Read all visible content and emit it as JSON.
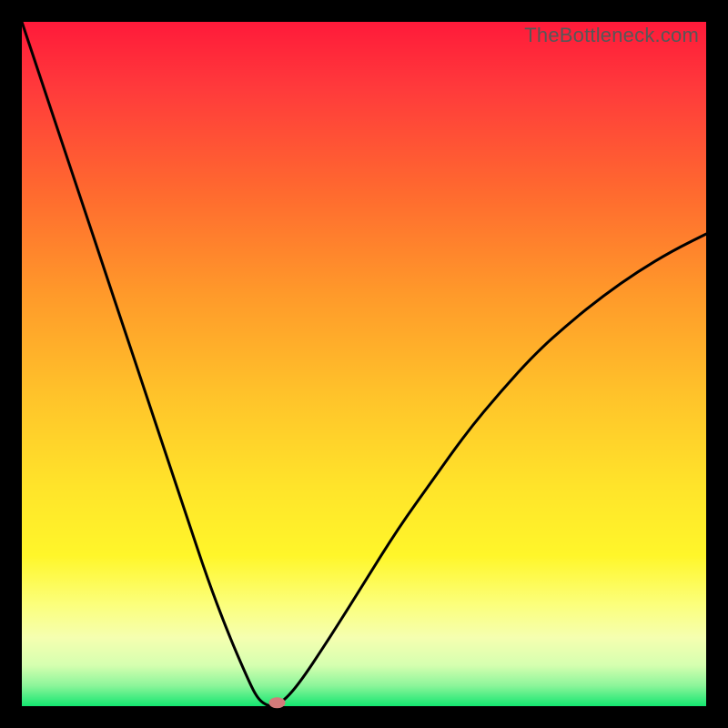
{
  "watermark": "TheBottleneck.com",
  "chart_data": {
    "type": "line",
    "title": "",
    "xlabel": "",
    "ylabel": "",
    "xlim": [
      0,
      100
    ],
    "ylim": [
      0,
      100
    ],
    "grid": false,
    "legend": false,
    "series": [
      {
        "name": "bottleneck-curve",
        "x": [
          0,
          3,
          6,
          9,
          12,
          15,
          18,
          21,
          24,
          27,
          30,
          33,
          34.5,
          36,
          37.3,
          40,
          45,
          50,
          55,
          60,
          65,
          70,
          75,
          80,
          85,
          90,
          95,
          100
        ],
        "y": [
          100,
          91,
          82,
          73,
          64,
          55,
          46,
          37,
          28,
          19,
          11,
          4,
          1,
          0,
          0,
          2.5,
          10,
          18,
          26,
          33,
          40,
          46,
          51.5,
          56,
          60,
          63.5,
          66.5,
          69
        ]
      }
    ],
    "marker": {
      "x": 37.3,
      "y": 0.5,
      "color": "#d47a7a"
    },
    "background_gradient": {
      "type": "vertical",
      "stops": [
        {
          "pos": 0.0,
          "color": "#ff1a3a"
        },
        {
          "pos": 0.25,
          "color": "#ff6a2f"
        },
        {
          "pos": 0.55,
          "color": "#ffc42a"
        },
        {
          "pos": 0.78,
          "color": "#fff62a"
        },
        {
          "pos": 0.94,
          "color": "#d6ffb0"
        },
        {
          "pos": 1.0,
          "color": "#14e670"
        }
      ]
    }
  }
}
